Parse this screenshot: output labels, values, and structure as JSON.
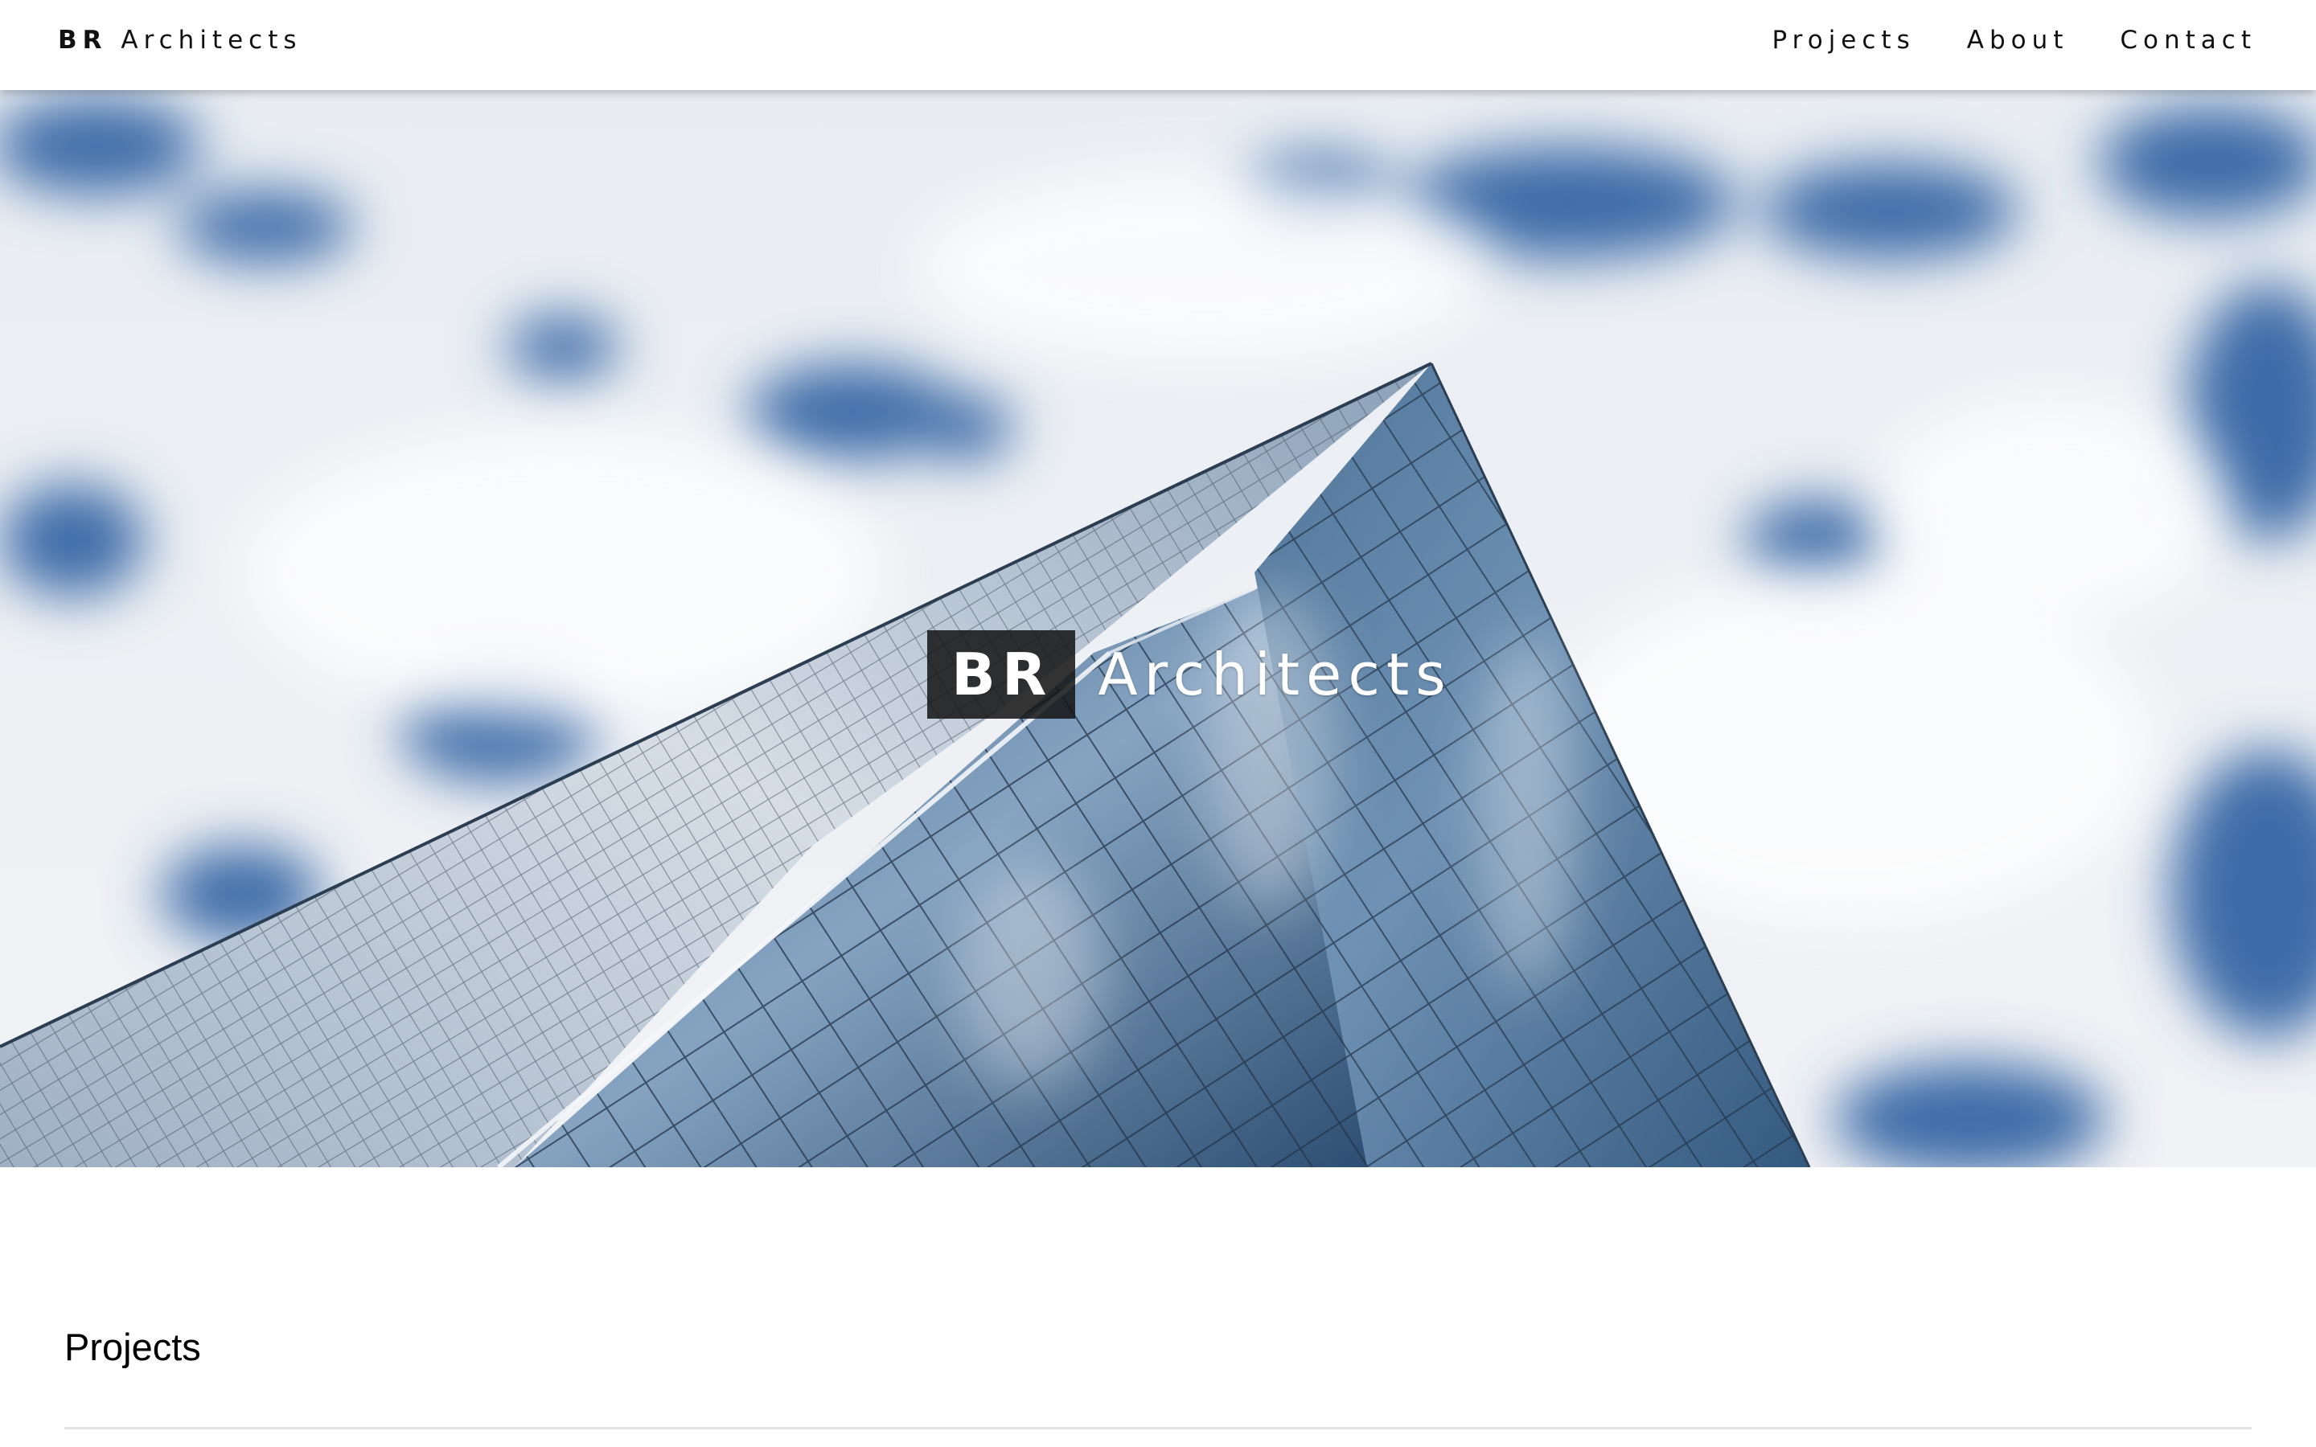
{
  "navbar": {
    "brand_bold": "BR",
    "brand_rest": "Architects",
    "links": [
      {
        "label": "Projects"
      },
      {
        "label": "About"
      },
      {
        "label": "Contact"
      }
    ]
  },
  "hero": {
    "title_bold": "BR",
    "title_rest": "Architects",
    "image_subject": "glass skyscraper against cloudy blue sky"
  },
  "main": {
    "section_title": "Projects"
  },
  "colors": {
    "text": "#111111",
    "sky_blue": "#3b6aa6",
    "cloud": "#f1f3f6",
    "glass_dark": "#2f5479",
    "divider": "#e4e4e4"
  }
}
